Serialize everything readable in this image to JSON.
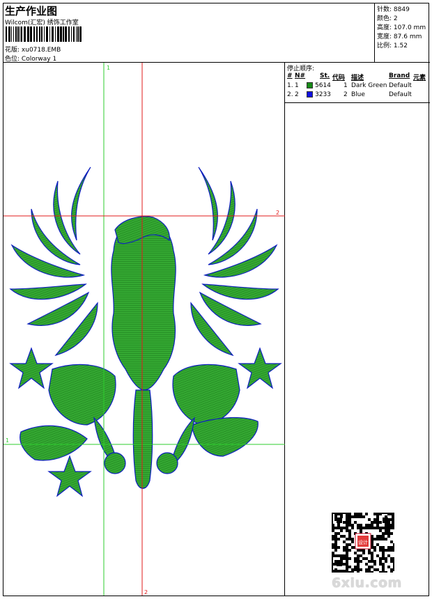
{
  "header": {
    "title": "生产作业图",
    "company": "Wilcom(汇宏) 绣饰工作室",
    "pattern_label": "花版:",
    "pattern_value": "xu0718.EMB",
    "colorway_label": "色位:",
    "colorway_value": "Colorway 1"
  },
  "stats": [
    {
      "label": "针数:",
      "value": "8849"
    },
    {
      "label": "颜色:",
      "value": "2"
    },
    {
      "label": "高度:",
      "value": "107.0 mm"
    },
    {
      "label": "宽度:",
      "value": "87.6 mm"
    },
    {
      "label": "比例:",
      "value": "1.52"
    }
  ],
  "design": {
    "guide_labels": {
      "green_top": "1",
      "green_left": "1",
      "red_right": "2",
      "red_bottom": "2"
    },
    "colors": {
      "fill": "#2a9a28",
      "outline": "#0d1fbf",
      "guide_green": "#2ecc2e",
      "guide_red": "#e21b1b"
    }
  },
  "stop_sequence": {
    "title": "停止顺序:",
    "headers": [
      "#",
      "N#",
      "St.",
      "代码",
      "描述",
      "Brand",
      "元素"
    ],
    "rows": [
      {
        "index": "1.",
        "n": "1",
        "color": "#178a17",
        "code": "5614",
        "st": "1",
        "desc": "Dark Green",
        "brand": "Default"
      },
      {
        "index": "2.",
        "n": "2",
        "color": "#1010e0",
        "code": "3233",
        "st": "2",
        "desc": "Blue",
        "brand": "Default"
      }
    ]
  },
  "watermark": "6xiu.com",
  "qr_stamp_text": "设计"
}
